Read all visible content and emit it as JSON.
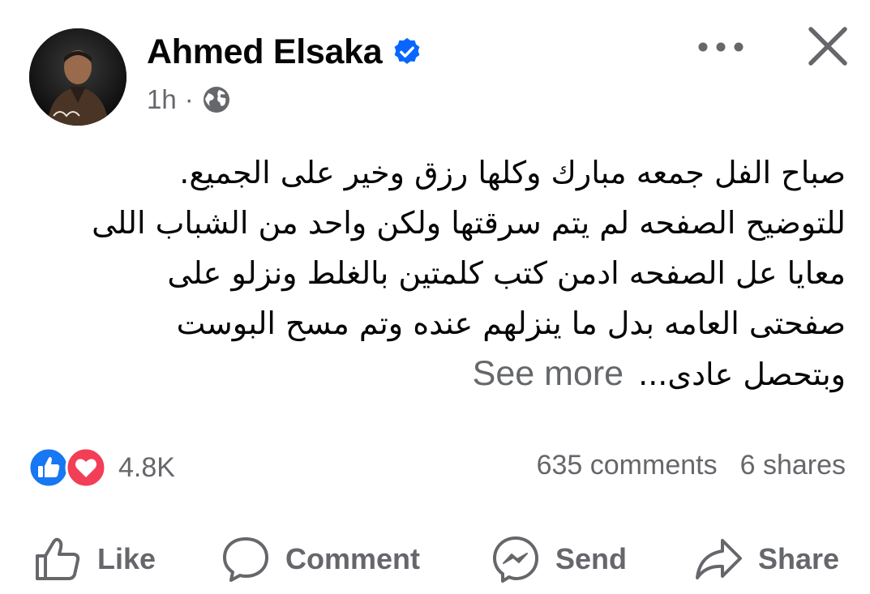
{
  "post": {
    "author": "Ahmed Elsaka",
    "time": "1h",
    "separator": "·",
    "lines": [
      "صباح الفل جمعه مبارك وكلها رزق وخير على الجميع.",
      "للتوضيح الصفحه لم يتم سرقتها ولكن واحد من الشباب اللى",
      "معايا عل الصفحه ادمن كتب كلمتين بالغلط ونزلو على",
      "صفحتى العامه بدل ما ينزلهم عنده وتم مسح البوست",
      "وبتحصل عادى..."
    ],
    "see_more": "See more"
  },
  "engagement": {
    "reactions_count": "4.8K",
    "comments": "635 comments",
    "shares": "6 shares"
  },
  "actions": {
    "like": "Like",
    "comment": "Comment",
    "send": "Send",
    "share": "Share"
  },
  "colors": {
    "verified": "#0866ff",
    "like_reaction": "#1877f2",
    "love_reaction": "#f33e58",
    "secondary_text": "#65676b"
  },
  "icons": [
    "avatar",
    "verified-badge-icon",
    "globe-icon",
    "more-options-icon",
    "close-icon",
    "like-reaction-icon",
    "love-reaction-icon",
    "thumbs-up-icon",
    "comment-icon",
    "messenger-icon",
    "share-icon"
  ]
}
